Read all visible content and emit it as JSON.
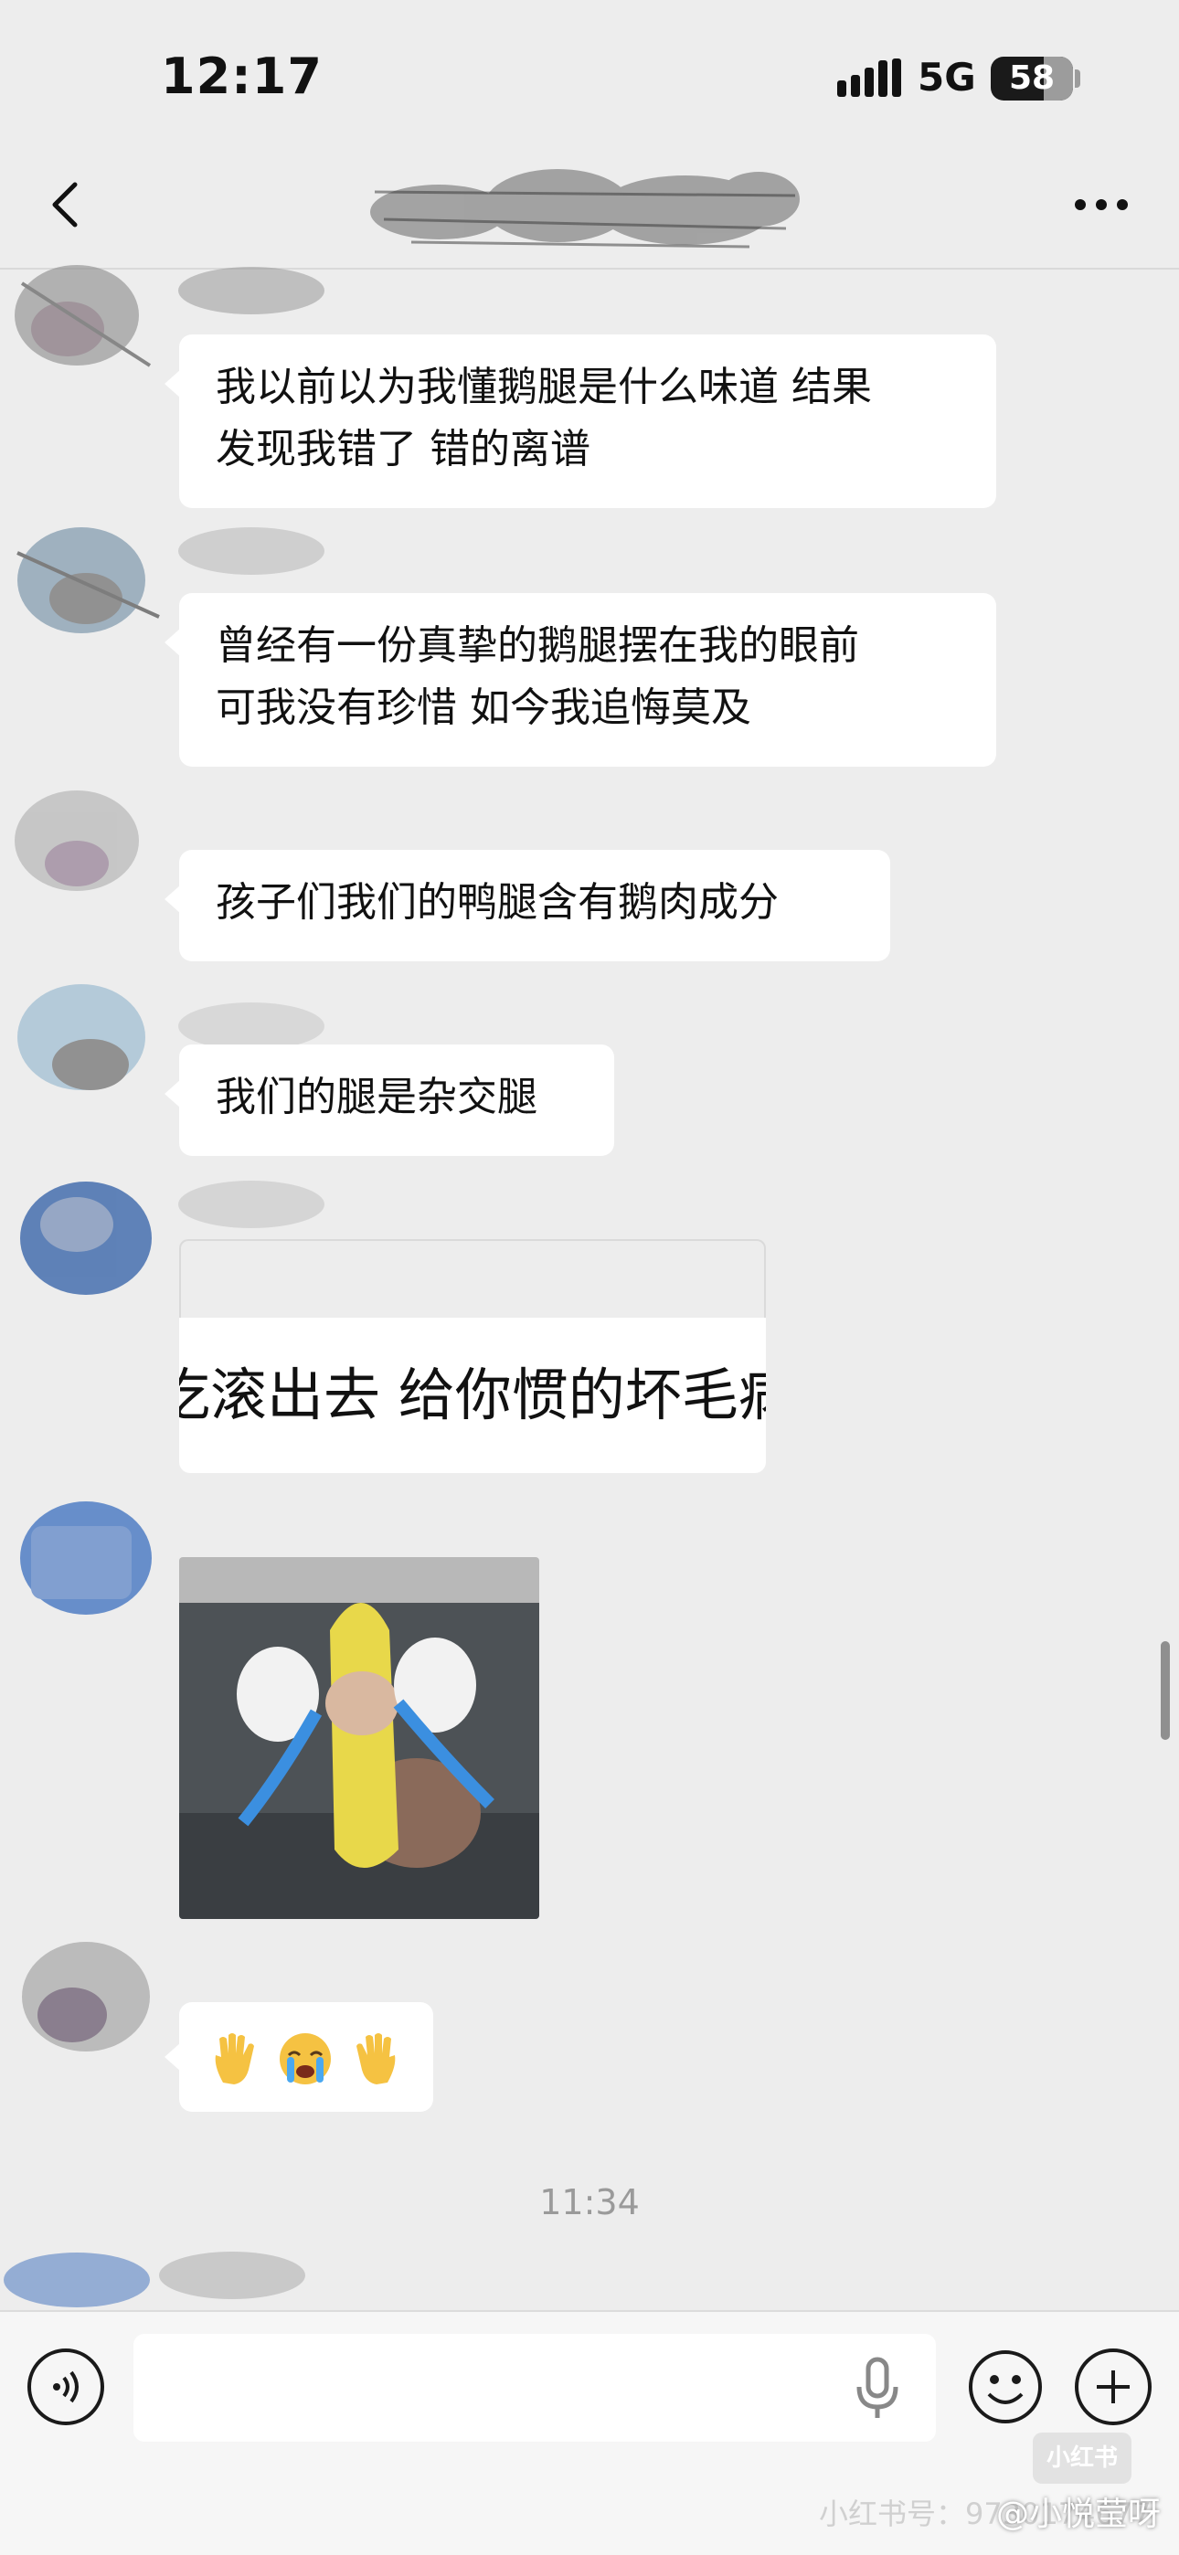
{
  "status_bar": {
    "time": "12:17",
    "network": "5G",
    "battery": "58"
  },
  "nav": {
    "back_icon": "chevron-left-icon",
    "more_icon": "ellipsis-icon"
  },
  "messages": [
    {
      "type": "text",
      "lines": [
        "我以前以为我懂鹅腿是什么味道 结果",
        "发现我错了 错的离谱"
      ]
    },
    {
      "type": "text",
      "lines": [
        "曾经有一份真挚的鹅腿摆在我的眼前",
        "可我没有珍惜 如今我追悔莫及"
      ]
    },
    {
      "type": "text",
      "lines": [
        "孩子们我们的鸭腿含有鹅肉成分"
      ]
    },
    {
      "type": "text",
      "lines": [
        "我们的腿是杂交腿"
      ]
    },
    {
      "type": "big-text",
      "text": "吃滚出去 给你惯的坏毛病"
    },
    {
      "type": "sticker",
      "icon": "crying-banana-cat-sticker"
    },
    {
      "type": "emoji",
      "emojis": [
        "raised-hand-emoji",
        "loudly-crying-emoji",
        "raised-hand-emoji"
      ]
    }
  ],
  "time_separator": "11:34",
  "input_bar": {
    "voice_icon": "voice-icon",
    "mic_icon": "microphone-icon",
    "emoji_icon": "smiley-icon",
    "add_icon": "plus-icon",
    "placeholder": ""
  },
  "watermark": {
    "logo": "小红书",
    "id": "小红书号：9730174677",
    "weibo": "@小悦莹呀"
  },
  "colors": {
    "background": "#ededed",
    "bubble": "#ffffff",
    "input_bar": "#f6f6f6"
  }
}
